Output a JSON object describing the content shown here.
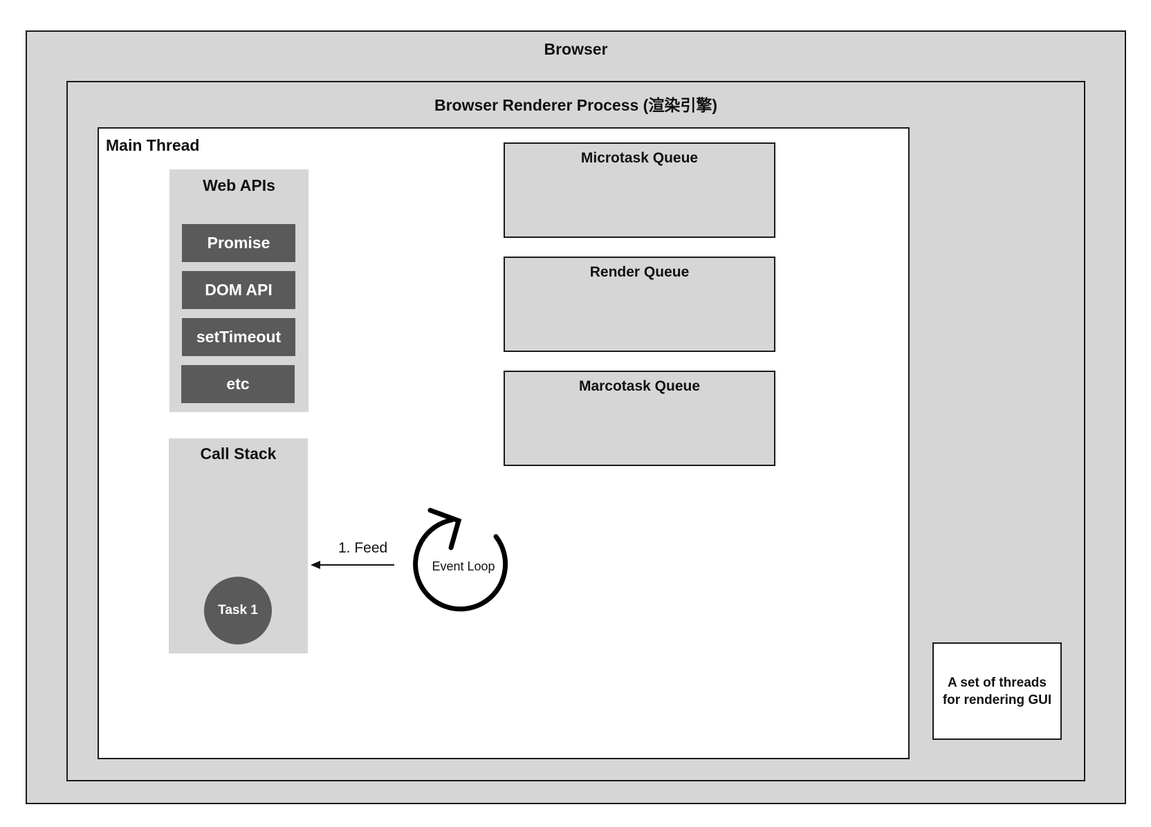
{
  "browser": {
    "title": "Browser"
  },
  "renderer": {
    "title": "Browser Renderer Process (渲染引擎)"
  },
  "main_thread": {
    "title": "Main Thread"
  },
  "web_apis": {
    "title": "Web APIs",
    "items": [
      "Promise",
      "DOM API",
      "setTimeout",
      "etc"
    ]
  },
  "call_stack": {
    "title": "Call Stack",
    "task": "Task 1"
  },
  "queues": [
    {
      "label": "Microtask Queue"
    },
    {
      "label": "Render Queue"
    },
    {
      "label": "Marcotask Queue"
    }
  ],
  "event_loop": {
    "label": "Event Loop"
  },
  "arrow": {
    "label": "1. Feed"
  },
  "gui_threads": {
    "label": "A set of threads for rendering GUI"
  },
  "colors": {
    "container_fill": "#d6d6d6",
    "dark_item": "#5a5a5a",
    "border": "#1a1a1a",
    "white": "#ffffff"
  }
}
